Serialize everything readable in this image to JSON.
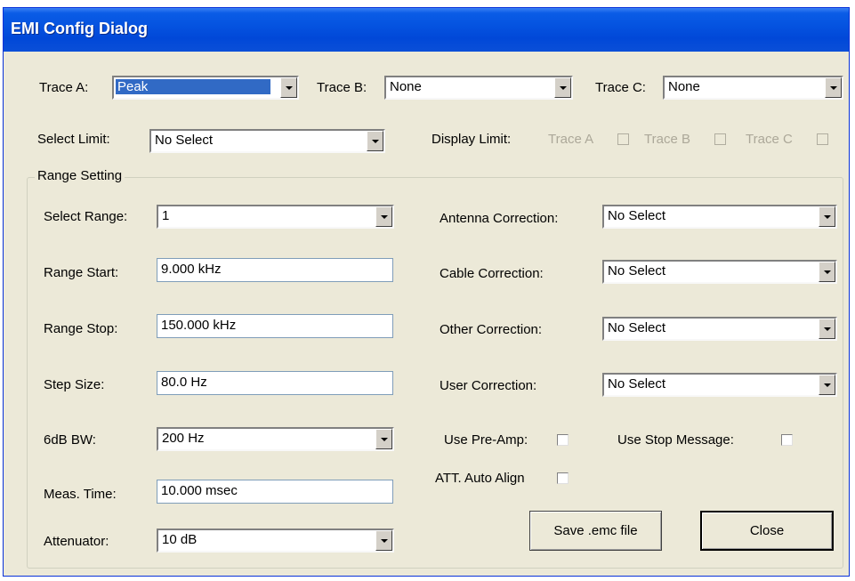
{
  "window": {
    "title": "EMI Config Dialog"
  },
  "traces": {
    "trace_a": {
      "label": "Trace A:",
      "value": "Peak"
    },
    "trace_b": {
      "label": "Trace B:",
      "value": "None"
    },
    "trace_c": {
      "label": "Trace C:",
      "value": "None"
    }
  },
  "limit": {
    "select_label": "Select Limit:",
    "select_value": "No Select",
    "display_label": "Display Limit:",
    "display_options": [
      "Trace A",
      "Trace B",
      "Trace C"
    ]
  },
  "range_group": {
    "title": "Range Setting",
    "select_range": {
      "label": "Select Range:",
      "value": "1"
    },
    "range_start": {
      "label": "Range Start:",
      "value": "9.000 kHz"
    },
    "range_stop": {
      "label": "Range Stop:",
      "value": "150.000 kHz"
    },
    "step_size": {
      "label": "Step Size:",
      "value": "80.0 Hz"
    },
    "bw": {
      "label": "6dB BW:",
      "value": "200 Hz"
    },
    "meas_time": {
      "label": "Meas. Time:",
      "value": "10.000 msec"
    },
    "attenuator": {
      "label": "Attenuator:",
      "value": "10 dB"
    },
    "antenna_correction": {
      "label": "Antenna Correction:",
      "value": "No Select"
    },
    "cable_correction": {
      "label": "Cable Correction:",
      "value": "No Select"
    },
    "other_correction": {
      "label": "Other Correction:",
      "value": "No Select"
    },
    "user_correction": {
      "label": "User Correction:",
      "value": "No Select"
    },
    "use_preamp": {
      "label": "Use Pre-Amp:"
    },
    "use_stop_message": {
      "label": "Use Stop Message:"
    },
    "att_auto_align": {
      "label": "ATT. Auto Align"
    }
  },
  "buttons": {
    "save": "Save .emc file",
    "close": "Close"
  }
}
